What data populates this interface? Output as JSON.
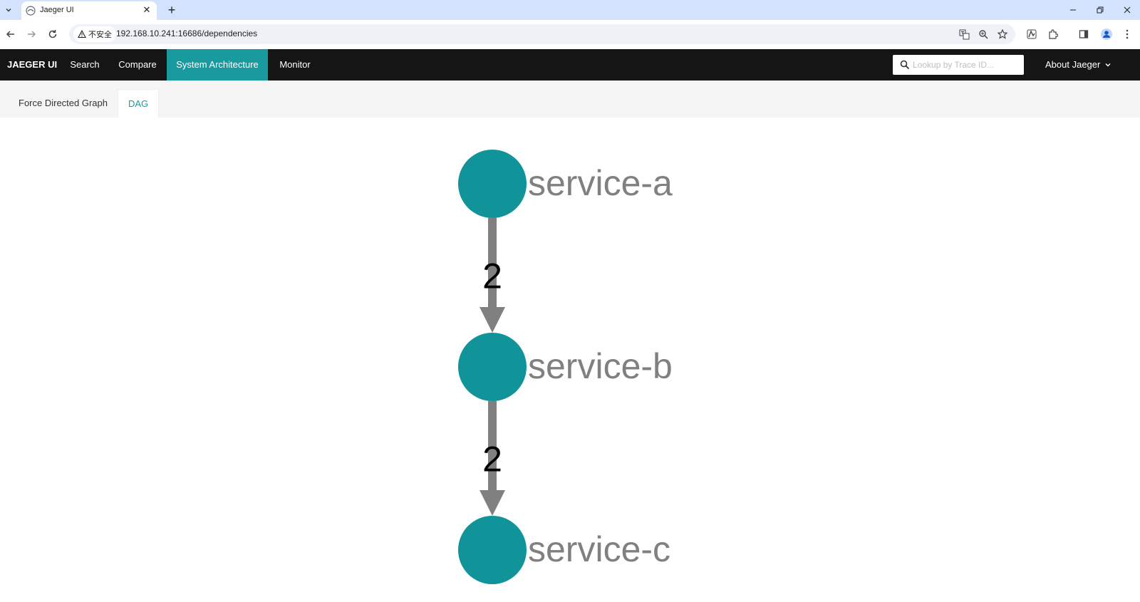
{
  "browser": {
    "tab_title": "Jaeger UI",
    "tab_close": "✕",
    "new_tab": "+",
    "security_label": "不安全",
    "url": "192.168.10.241:16686/dependencies"
  },
  "topnav": {
    "brand": "JAEGER UI",
    "items": [
      {
        "label": "Search",
        "active": false
      },
      {
        "label": "Compare",
        "active": false
      },
      {
        "label": "System Architecture",
        "active": true
      },
      {
        "label": "Monitor",
        "active": false
      }
    ],
    "trace_lookup_placeholder": "Lookup by Trace ID...",
    "about_label": "About Jaeger"
  },
  "subtabs": [
    {
      "label": "Force Directed Graph",
      "active": false
    },
    {
      "label": "DAG",
      "active": true
    }
  ],
  "graph": {
    "nodes": [
      {
        "id": "service-a",
        "label": "service-a"
      },
      {
        "id": "service-b",
        "label": "service-b"
      },
      {
        "id": "service-c",
        "label": "service-c"
      }
    ],
    "edges": [
      {
        "from": "service-a",
        "to": "service-b",
        "label": "2"
      },
      {
        "from": "service-b",
        "to": "service-c",
        "label": "2"
      }
    ]
  },
  "colors": {
    "accent": "#199a9f",
    "nav_bg": "#151515",
    "node_fill": "#11939a",
    "edge_color": "#808080",
    "node_label_color": "#808080",
    "edge_label_color": "#000000",
    "tabstrip_bg": "#d3e3fd"
  },
  "icons": {
    "tab_favicon": "jaeger-logo-icon",
    "back": "arrow-left-icon",
    "forward": "arrow-right-icon",
    "reload": "reload-icon",
    "security": "warning-triangle-icon",
    "translate": "translate-icon",
    "zoom": "zoom-icon",
    "bookmark": "star-icon",
    "trace_search": "search-icon",
    "about_caret": "chevron-down-icon"
  }
}
